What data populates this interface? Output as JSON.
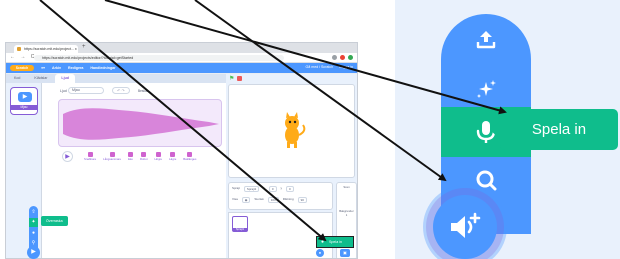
{
  "browser": {
    "tab_title": "https://scratch.mit.edu/project... x",
    "url": "https://scratch.mit.edu/projects/editor/?tutorial=getStarted",
    "nav": "← → C"
  },
  "scratch_menu": {
    "logo": "Scratch",
    "items": [
      "Arkiv",
      "Redigera",
      "Handledningar"
    ],
    "right_items": [
      "Gå med i Scratch",
      "Logga in"
    ]
  },
  "editor_tabs": [
    "Kod",
    "Klädslar",
    "Ljud"
  ],
  "sound_editor": {
    "sound_label": "Ljud",
    "sound_name": "Mjau",
    "trim_label": "Beskär",
    "effects": [
      "Snabbare",
      "Långsammare",
      "Eko",
      "Robot",
      "Högre",
      "Lägre",
      "Baklänges"
    ]
  },
  "sound_list": {
    "item_name": "Mjau",
    "item_size": "0.85"
  },
  "sprite_info": {
    "sprite_label": "Sprajt",
    "sprite_name": "Sprajt1",
    "x_label": "x",
    "x_value": "0",
    "y_label": "y",
    "y_value": "0",
    "show_label": "Visa",
    "size_label": "Storlek",
    "size_value": "100",
    "direction_label": "Riktning",
    "direction_value": "90"
  },
  "sprite_list": {
    "thumb_name": "Sprajt1"
  },
  "backdrop_panel": {
    "title": "Scen",
    "subtitle": "Bakgrunder",
    "count": "1"
  },
  "mini_tooltip": "Överraska",
  "mini_record_label": "Spela in",
  "zoom": {
    "tooltip": "Spela in",
    "icons": [
      "upload-icon",
      "sparkle-icon",
      "microphone-icon",
      "search-icon",
      "add-sound-icon"
    ]
  },
  "colors": {
    "scratch_blue": "#4c97ff",
    "highlight_green": "#0fbd8c",
    "sound_purple": "#cf63cf",
    "accent_purple": "#855cd6"
  }
}
